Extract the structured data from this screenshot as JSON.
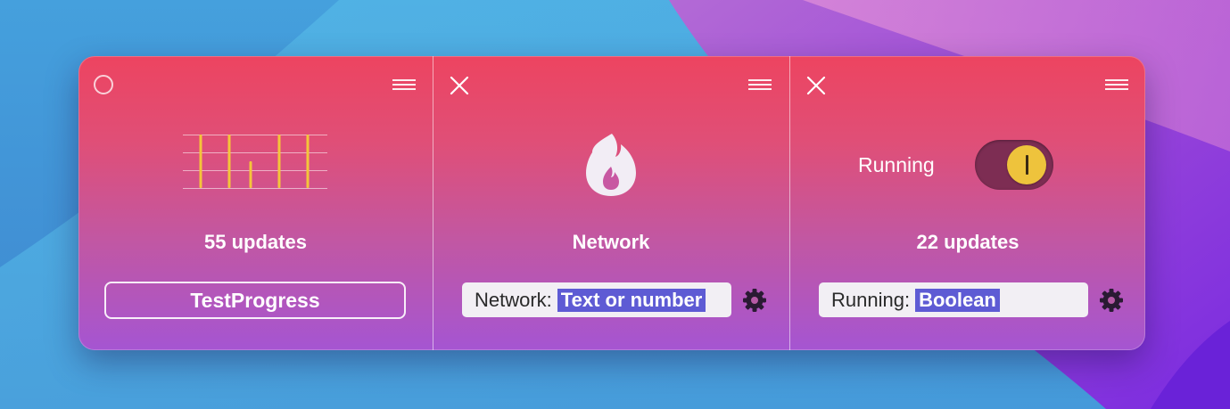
{
  "panels": [
    {
      "name": "chart-panel",
      "stat": "55 updates",
      "button_label": "TestProgress",
      "chart_data": {
        "type": "bar",
        "values": [
          1.0,
          1.0,
          0.5,
          1.0,
          1.0
        ],
        "color": "#f4c53a",
        "grid": true
      }
    },
    {
      "name": "network-panel",
      "title": "Network",
      "field_label": "Network:",
      "field_value": "Text or number",
      "icon": "flame-icon"
    },
    {
      "name": "running-panel",
      "toggle_label": "Running",
      "toggle_on": true,
      "stat": "22 updates",
      "field_label": "Running:",
      "field_value": "Boolean"
    }
  ],
  "colors": {
    "gradient_top": "#ed4460",
    "gradient_bottom": "#a555d2",
    "selection": "#5e5bd4",
    "toggle_track": "#7d2d53",
    "toggle_knob": "#eec33c"
  }
}
